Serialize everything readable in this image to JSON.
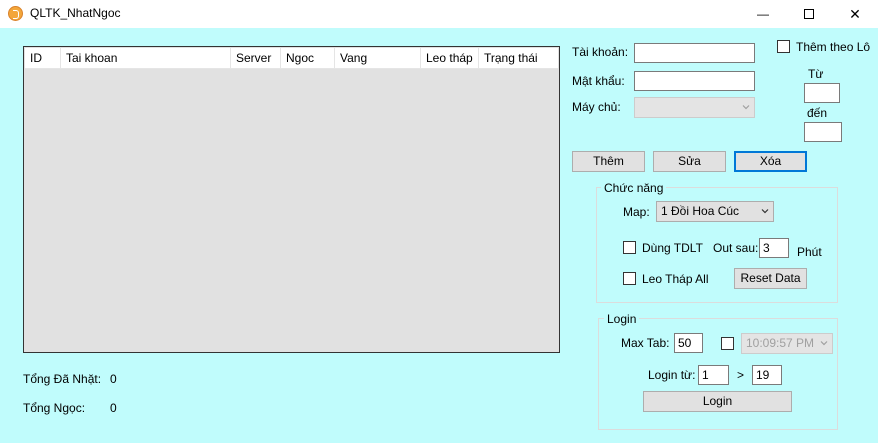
{
  "window": {
    "title": "QLTK_NhatNgoc",
    "minimize_glyph": "—",
    "maximize_glyph": "☐",
    "close_glyph": "✕"
  },
  "listview": {
    "columns": [
      "ID",
      "Tai khoan",
      "Server",
      "Ngoc",
      "Vang",
      "Leo tháp",
      "Trạng thái"
    ]
  },
  "summary": {
    "total_label": "Tổng Đã Nhặt:",
    "total_value": "0",
    "ngoc_label": "Tổng Ngọc:",
    "ngoc_value": "0"
  },
  "account": {
    "username_label": "Tài khoản:",
    "username_value": "",
    "password_label": "Mật khẩu:",
    "password_value": "",
    "server_label": "Máy chủ:",
    "server_value": "",
    "batch_label": "Thêm theo Lô",
    "from_label": "Từ",
    "from_value": "",
    "to_label": "đến",
    "to_value": ""
  },
  "actions": {
    "add_label": "Thêm",
    "edit_label": "Sửa",
    "delete_label": "Xóa"
  },
  "features": {
    "group_title": "Chức năng",
    "map_label": "Map:",
    "map_value": "1 Đồi Hoa Cúc",
    "tdlt_label": "Dùng TDLT",
    "out_label": "Out sau:",
    "out_value": "3",
    "minute_label": "Phút",
    "climb_label": "Leo Tháp All",
    "reset_label": "Reset Data"
  },
  "login": {
    "group_title": "Login",
    "max_tab_label": "Max Tab:",
    "max_tab_value": "50",
    "time_value": "10:09:57 PM",
    "login_from_label": "Login từ:",
    "from_value": "1",
    "separator": ">",
    "to_value": "19",
    "login_button": "Login"
  }
}
